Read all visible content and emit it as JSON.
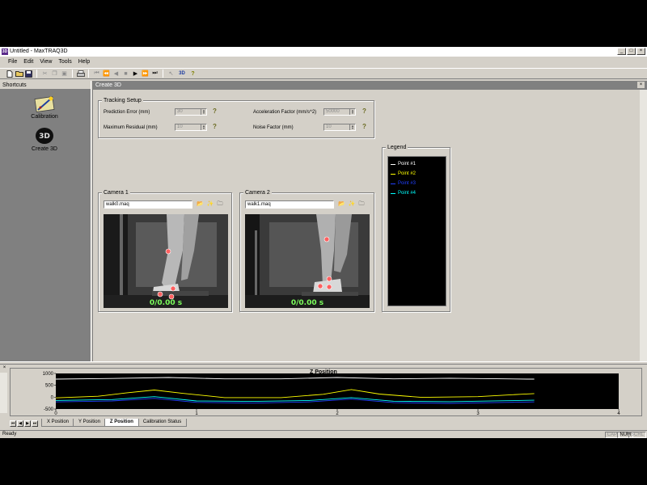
{
  "window": {
    "title": "Untitled - MaxTRAQ3D",
    "app_icon": "3D",
    "buttons": {
      "minimize": "_",
      "maximize": "□",
      "close": "×"
    }
  },
  "menu": [
    "File",
    "Edit",
    "View",
    "Tools",
    "Help"
  ],
  "toolbar": {
    "three_d_label": "3D",
    "help_label": "?"
  },
  "shortcuts": {
    "header": "Shortcuts",
    "items": [
      {
        "label": "Calibration",
        "icon": "calibration-wand-icon"
      },
      {
        "label": "Create 3D",
        "icon": "create-3d-icon"
      }
    ]
  },
  "document": {
    "header": "Create 3D",
    "close": "×"
  },
  "tracking": {
    "label": "Tracking Setup",
    "prediction_error": {
      "label": "Prediction Error (mm)",
      "value": "30"
    },
    "max_residual": {
      "label": "Maximum Residual (mm)",
      "value": "10"
    },
    "accel_factor": {
      "label": "Acceleration Factor (mm/s^2)",
      "value": "50000"
    },
    "noise_factor": {
      "label": "Noise Factor (mm)",
      "value": "10"
    },
    "help": "?"
  },
  "cameras": [
    {
      "label": "Camera 1",
      "file": "walk0.maq",
      "time": "0/0.00 s"
    },
    {
      "label": "Camera 2",
      "file": "walk1.maq",
      "time": "0/0.00 s"
    }
  ],
  "legend": {
    "label": "Legend",
    "items": [
      {
        "name": "Point #1",
        "color": "#ffffff"
      },
      {
        "name": "Point #2",
        "color": "#ffff00"
      },
      {
        "name": "Point #3",
        "color": "#2040ff"
      },
      {
        "name": "Point #4",
        "color": "#00ffff"
      }
    ]
  },
  "chart_data": {
    "type": "line",
    "title": "Z Position",
    "xlabel": "",
    "ylabel": "",
    "xlim": [
      0,
      4
    ],
    "ylim": [
      -500,
      1000
    ],
    "x_ticks": [
      "0",
      "1",
      "2",
      "3",
      "4"
    ],
    "y_ticks": [
      "1000",
      "500",
      "0",
      "-500"
    ],
    "background": "#000000",
    "series": [
      {
        "name": "Point #1",
        "color": "#ffffff",
        "x": [
          0,
          0.4,
          0.8,
          1.2,
          1.6,
          2.0,
          2.4,
          2.8,
          3.2,
          3.35,
          3.4
        ],
        "values": [
          760,
          790,
          830,
          770,
          770,
          830,
          770,
          800,
          770,
          760,
          760
        ]
      },
      {
        "name": "Point #2",
        "color": "#ffff00",
        "x": [
          0,
          0.3,
          0.5,
          0.7,
          0.9,
          1.2,
          1.6,
          1.9,
          2.1,
          2.3,
          2.6,
          3.0,
          3.3,
          3.4
        ],
        "values": [
          -30,
          40,
          180,
          300,
          160,
          -20,
          -20,
          120,
          320,
          130,
          -10,
          20,
          120,
          150
        ]
      },
      {
        "name": "Point #3",
        "color": "#2040ff",
        "x": [
          0,
          0.4,
          0.7,
          1.0,
          1.4,
          1.8,
          2.1,
          2.4,
          2.8,
          3.2,
          3.4
        ],
        "values": [
          -200,
          -160,
          -50,
          -220,
          -250,
          -200,
          -80,
          -230,
          -260,
          -220,
          -200
        ]
      },
      {
        "name": "Point #4",
        "color": "#00ffff",
        "x": [
          0,
          0.4,
          0.7,
          1.0,
          1.4,
          1.8,
          2.1,
          2.4,
          2.8,
          3.2,
          3.4
        ],
        "values": [
          -140,
          -100,
          20,
          -160,
          -180,
          -140,
          -20,
          -170,
          -190,
          -150,
          -130
        ]
      }
    ]
  },
  "bottom_tabs": [
    "X Position",
    "Y Position",
    "Z Position",
    "Calibration Status"
  ],
  "active_tab": "Z Position",
  "status": {
    "text": "Ready",
    "caps": "CAP",
    "num": "NUM",
    "scrl": "SCRL"
  }
}
